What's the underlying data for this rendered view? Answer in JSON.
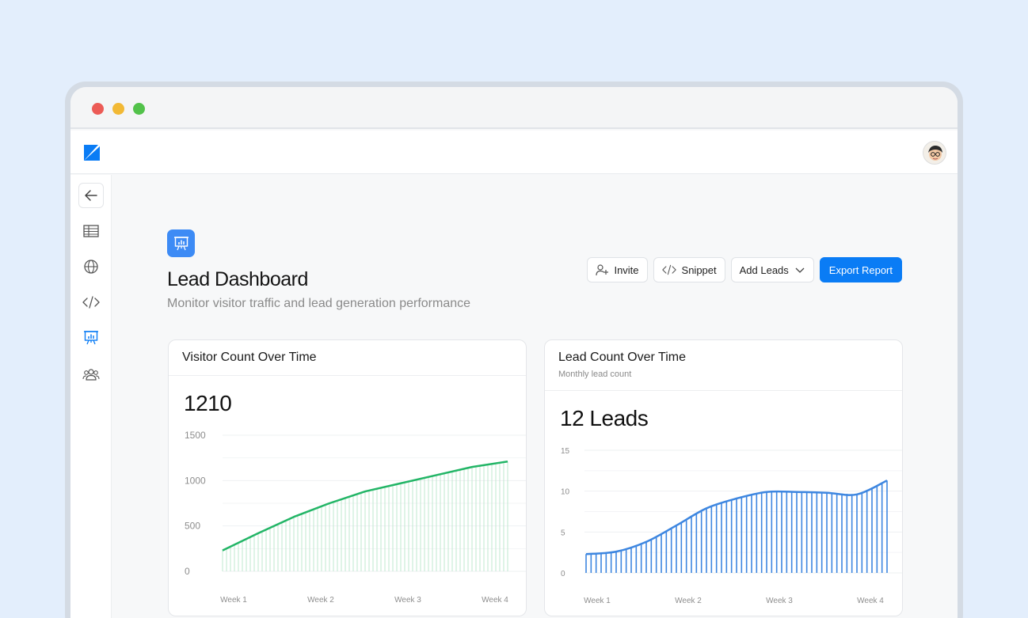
{
  "colors": {
    "accent": "#0a7cf5",
    "visitor_line": "#22b566",
    "lead_line": "#3d86e0"
  },
  "header": {
    "avatar_icon": "user-avatar"
  },
  "sidebar": {
    "items": [
      {
        "icon": "arrow-left-icon"
      },
      {
        "icon": "table-icon"
      },
      {
        "icon": "globe-icon"
      },
      {
        "icon": "code-icon"
      },
      {
        "icon": "presentation-chart-icon"
      },
      {
        "icon": "users-icon"
      }
    ]
  },
  "page": {
    "title": "Lead Dashboard",
    "subtitle": "Monitor visitor traffic and lead generation performance"
  },
  "actions": {
    "invite": "Invite",
    "snippet": "Snippet",
    "add_leads": "Add Leads",
    "export": "Export Report"
  },
  "visitor_card": {
    "title": "Visitor Count Over Time",
    "value": "1210"
  },
  "lead_card": {
    "title": "Lead Count Over Time",
    "description": "Monthly lead count",
    "value": "12 Leads"
  },
  "chart_data": [
    {
      "type": "area",
      "title": "Visitor Count Over Time",
      "x": [
        "Week 1",
        "Week 2",
        "Week 3",
        "Week 4"
      ],
      "x_points": [
        0,
        0.5,
        1,
        1.5,
        2,
        2.5,
        3,
        3.5,
        4
      ],
      "series": [
        {
          "values": [
            230,
            420,
            600,
            750,
            880,
            970,
            1060,
            1150,
            1210
          ]
        }
      ],
      "yticks": [
        0,
        500,
        1000,
        1500
      ],
      "ylim": [
        0,
        1500
      ],
      "grid": true
    },
    {
      "type": "area",
      "title": "Lead Count Over Time",
      "x": [
        "Week 1",
        "Week 2",
        "Week 3",
        "Week 4"
      ],
      "x_points": [
        0,
        0.4,
        0.8,
        1.2,
        1.6,
        2,
        2.4,
        2.8,
        3.2,
        3.6,
        4
      ],
      "series": [
        {
          "values": [
            2.3,
            2.6,
            3.8,
            5.8,
            7.9,
            9.1,
            9.9,
            9.9,
            9.8,
            9.6,
            11.3
          ]
        }
      ],
      "yticks": [
        0,
        5,
        10,
        15
      ],
      "ylim": [
        0,
        15
      ],
      "grid": true
    }
  ]
}
